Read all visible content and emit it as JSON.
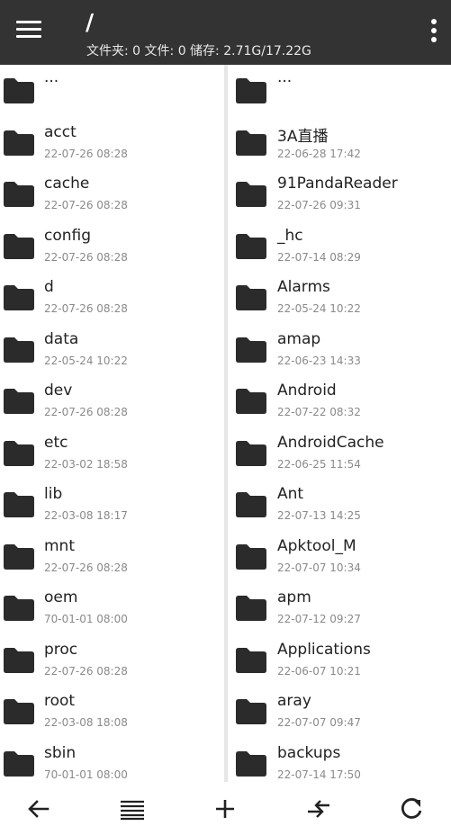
{
  "header": {
    "path": "/",
    "stats": "文件夹: 0 文件: 0 储存: 2.71G/17.22G",
    "menu_icon": "hamburger-menu-icon",
    "more_icon": "more-vertical-icon"
  },
  "left_pane": {
    "items": [
      {
        "name": "...",
        "date": ""
      },
      {
        "name": "acct",
        "date": "22-07-26 08:28"
      },
      {
        "name": "cache",
        "date": "22-07-26 08:28"
      },
      {
        "name": "config",
        "date": "22-07-26 08:28"
      },
      {
        "name": "d",
        "date": "22-07-26 08:28"
      },
      {
        "name": "data",
        "date": "22-05-24 10:22"
      },
      {
        "name": "dev",
        "date": "22-07-26 08:28"
      },
      {
        "name": "etc",
        "date": "22-03-02 18:58"
      },
      {
        "name": "lib",
        "date": "22-03-08 18:17"
      },
      {
        "name": "mnt",
        "date": "22-07-26 08:28"
      },
      {
        "name": "oem",
        "date": "70-01-01 08:00"
      },
      {
        "name": "proc",
        "date": "22-07-26 08:28"
      },
      {
        "name": "root",
        "date": "22-03-08 18:08"
      },
      {
        "name": "sbin",
        "date": "70-01-01 08:00"
      }
    ]
  },
  "right_pane": {
    "items": [
      {
        "name": "...",
        "date": ""
      },
      {
        "name": "3A直播",
        "date": "22-06-28 17:42"
      },
      {
        "name": "91PandaReader",
        "date": "22-07-26 09:31"
      },
      {
        "name": "_hc",
        "date": "22-07-14 08:29"
      },
      {
        "name": "Alarms",
        "date": "22-05-24 10:22"
      },
      {
        "name": "amap",
        "date": "22-06-23 14:33"
      },
      {
        "name": "Android",
        "date": "22-07-22 08:32"
      },
      {
        "name": "AndroidCache",
        "date": "22-06-25 11:54"
      },
      {
        "name": "Ant",
        "date": "22-07-13 14:25"
      },
      {
        "name": "Apktool_M",
        "date": "22-07-07 10:34"
      },
      {
        "name": "apm",
        "date": "22-07-12 09:27"
      },
      {
        "name": "Applications",
        "date": "22-06-07 10:21"
      },
      {
        "name": "aray",
        "date": "22-07-07 09:47"
      },
      {
        "name": "backups",
        "date": "22-07-14 17:50"
      }
    ]
  },
  "bottom_bar": {
    "buttons": [
      {
        "icon": "back-arrow-icon"
      },
      {
        "icon": "list-view-icon"
      },
      {
        "icon": "add-icon"
      },
      {
        "icon": "swap-panes-icon"
      },
      {
        "icon": "refresh-icon"
      }
    ]
  },
  "colors": {
    "topbar": "#333333",
    "folder": "#2b2b2b",
    "divider": "#e6e6e6",
    "date_text": "#8a8a8a"
  }
}
